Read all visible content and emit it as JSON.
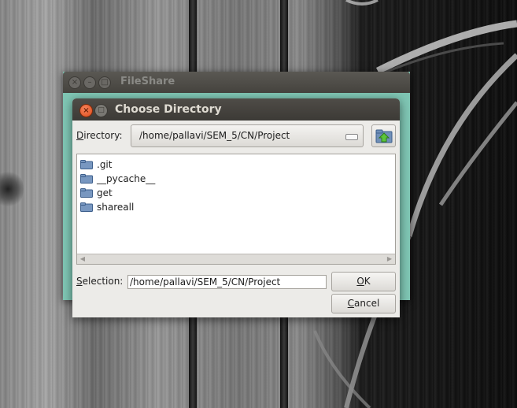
{
  "desktop": {},
  "back_window": {
    "title": "FileShare"
  },
  "dialog": {
    "title": "Choose Directory",
    "directory_label_prefix": "D",
    "directory_label_rest": "irectory:",
    "directory_value": "/home/pallavi/SEM_5/CN/Project",
    "up_button_icon": "folder-up-icon",
    "items": [
      {
        "label": ".git"
      },
      {
        "label": "__pycache__"
      },
      {
        "label": "get"
      },
      {
        "label": "shareall"
      }
    ],
    "selection_label_prefix": "S",
    "selection_label_rest": "election:",
    "selection_value": "/home/pallavi/SEM_5/CN/Project",
    "ok_prefix": "O",
    "ok_rest": "K",
    "cancel_prefix": "C",
    "cancel_rest": "ancel"
  },
  "colors": {
    "window_accent": "#7fc6b4",
    "close_button": "#de4b1a",
    "folder_icon": "#6f8fb8"
  }
}
